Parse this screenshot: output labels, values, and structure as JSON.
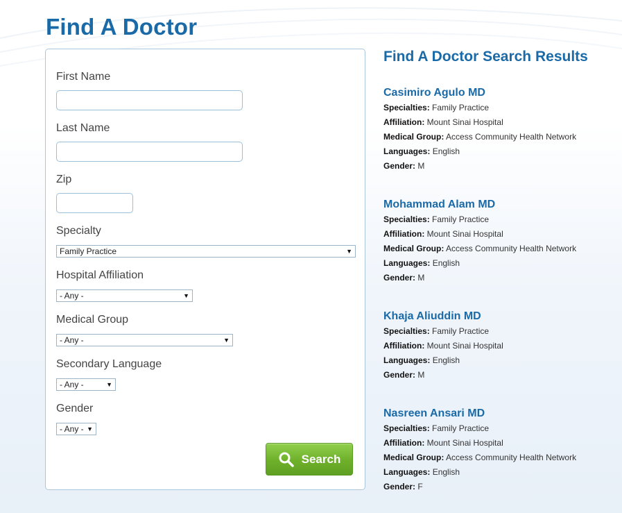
{
  "page": {
    "title": "Find A Doctor"
  },
  "form": {
    "first_name": {
      "label": "First Name",
      "value": "",
      "placeholder": ""
    },
    "last_name": {
      "label": "Last Name",
      "value": "",
      "placeholder": ""
    },
    "zip": {
      "label": "Zip",
      "value": "",
      "placeholder": ""
    },
    "specialty": {
      "label": "Specialty",
      "selected": "Family Practice"
    },
    "hospital_affiliation": {
      "label": "Hospital Affiliation",
      "selected": "- Any -"
    },
    "medical_group": {
      "label": "Medical Group",
      "selected": "- Any -"
    },
    "secondary_language": {
      "label": "Secondary Language",
      "selected": "- Any -"
    },
    "gender": {
      "label": "Gender",
      "selected": "- Any -"
    },
    "search_label": "Search",
    "select_arrow": "▼"
  },
  "results": {
    "title": "Find A Doctor Search Results",
    "field_labels": {
      "specialties": "Specialties:",
      "affiliation": "Affiliation:",
      "medical_group": "Medical Group:",
      "languages": "Languages:",
      "gender": "Gender:"
    },
    "items": [
      {
        "name": "Casimiro Agulo MD",
        "specialties": "Family Practice",
        "affiliation": "Mount Sinai Hospital",
        "medical_group": "Access Community Health Network",
        "languages": "English",
        "gender": "M"
      },
      {
        "name": "Mohammad Alam MD",
        "specialties": "Family Practice",
        "affiliation": "Mount Sinai Hospital",
        "medical_group": "Access Community Health Network",
        "languages": "English",
        "gender": "M"
      },
      {
        "name": "Khaja Aliuddin MD",
        "specialties": "Family Practice",
        "affiliation": "Mount Sinai Hospital",
        "languages": "English",
        "gender": "M"
      },
      {
        "name": "Nasreen Ansari MD",
        "specialties": "Family Practice",
        "affiliation": "Mount Sinai Hospital",
        "medical_group": "Access Community Health Network",
        "languages": "English",
        "gender": "F"
      }
    ]
  },
  "colors": {
    "title_blue": "#1a6aa8",
    "button_green": "#6fb02b",
    "panel_border": "#a9c6dc"
  },
  "icons": {
    "search_button": "search-icon",
    "dropdown": "chevron-down-icon"
  }
}
